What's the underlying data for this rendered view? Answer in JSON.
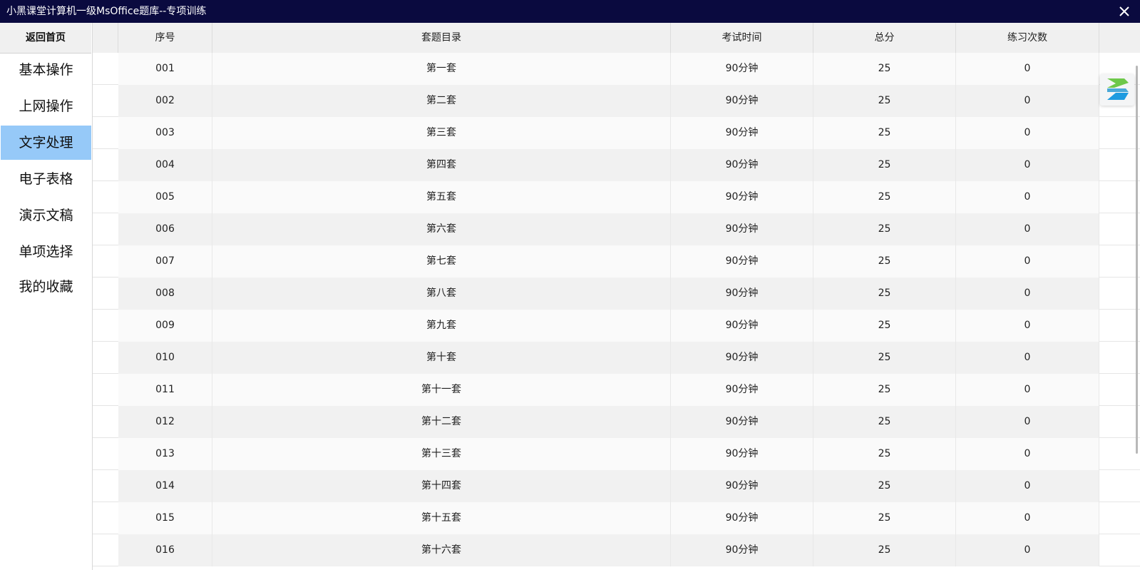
{
  "window": {
    "title": "小黑课堂计算机一级MsOffice题库--专项训练",
    "close_icon": "close-icon"
  },
  "sidebar": {
    "home_label": "返回首页",
    "items": [
      {
        "label": "基本操作",
        "active": false
      },
      {
        "label": "上网操作",
        "active": false
      },
      {
        "label": "文字处理",
        "active": true
      },
      {
        "label": "电子表格",
        "active": false
      },
      {
        "label": "演示文稿",
        "active": false
      },
      {
        "label": "单项选择",
        "active": false
      },
      {
        "label": "我的收藏",
        "active": false
      }
    ]
  },
  "table": {
    "columns": [
      "序号",
      "套题目录",
      "考试时间",
      "总分",
      "练习次数"
    ],
    "rows": [
      [
        "001",
        "第一套",
        "90分钟",
        "25",
        "0"
      ],
      [
        "002",
        "第二套",
        "90分钟",
        "25",
        "0"
      ],
      [
        "003",
        "第三套",
        "90分钟",
        "25",
        "0"
      ],
      [
        "004",
        "第四套",
        "90分钟",
        "25",
        "0"
      ],
      [
        "005",
        "第五套",
        "90分钟",
        "25",
        "0"
      ],
      [
        "006",
        "第六套",
        "90分钟",
        "25",
        "0"
      ],
      [
        "007",
        "第七套",
        "90分钟",
        "25",
        "0"
      ],
      [
        "008",
        "第八套",
        "90分钟",
        "25",
        "0"
      ],
      [
        "009",
        "第九套",
        "90分钟",
        "25",
        "0"
      ],
      [
        "010",
        "第十套",
        "90分钟",
        "25",
        "0"
      ],
      [
        "011",
        "第十一套",
        "90分钟",
        "25",
        "0"
      ],
      [
        "012",
        "第十二套",
        "90分钟",
        "25",
        "0"
      ],
      [
        "013",
        "第十三套",
        "90分钟",
        "25",
        "0"
      ],
      [
        "014",
        "第十四套",
        "90分钟",
        "25",
        "0"
      ],
      [
        "015",
        "第十五套",
        "90分钟",
        "25",
        "0"
      ],
      [
        "016",
        "第十六套",
        "90分钟",
        "25",
        "0"
      ]
    ]
  },
  "widget": {
    "icon": "app-logo-icon"
  },
  "colors": {
    "titlebar": "#0a0a3f",
    "active_item": "#96c9f8",
    "row_odd": "#fafafa",
    "row_even": "#f1f1f1"
  }
}
